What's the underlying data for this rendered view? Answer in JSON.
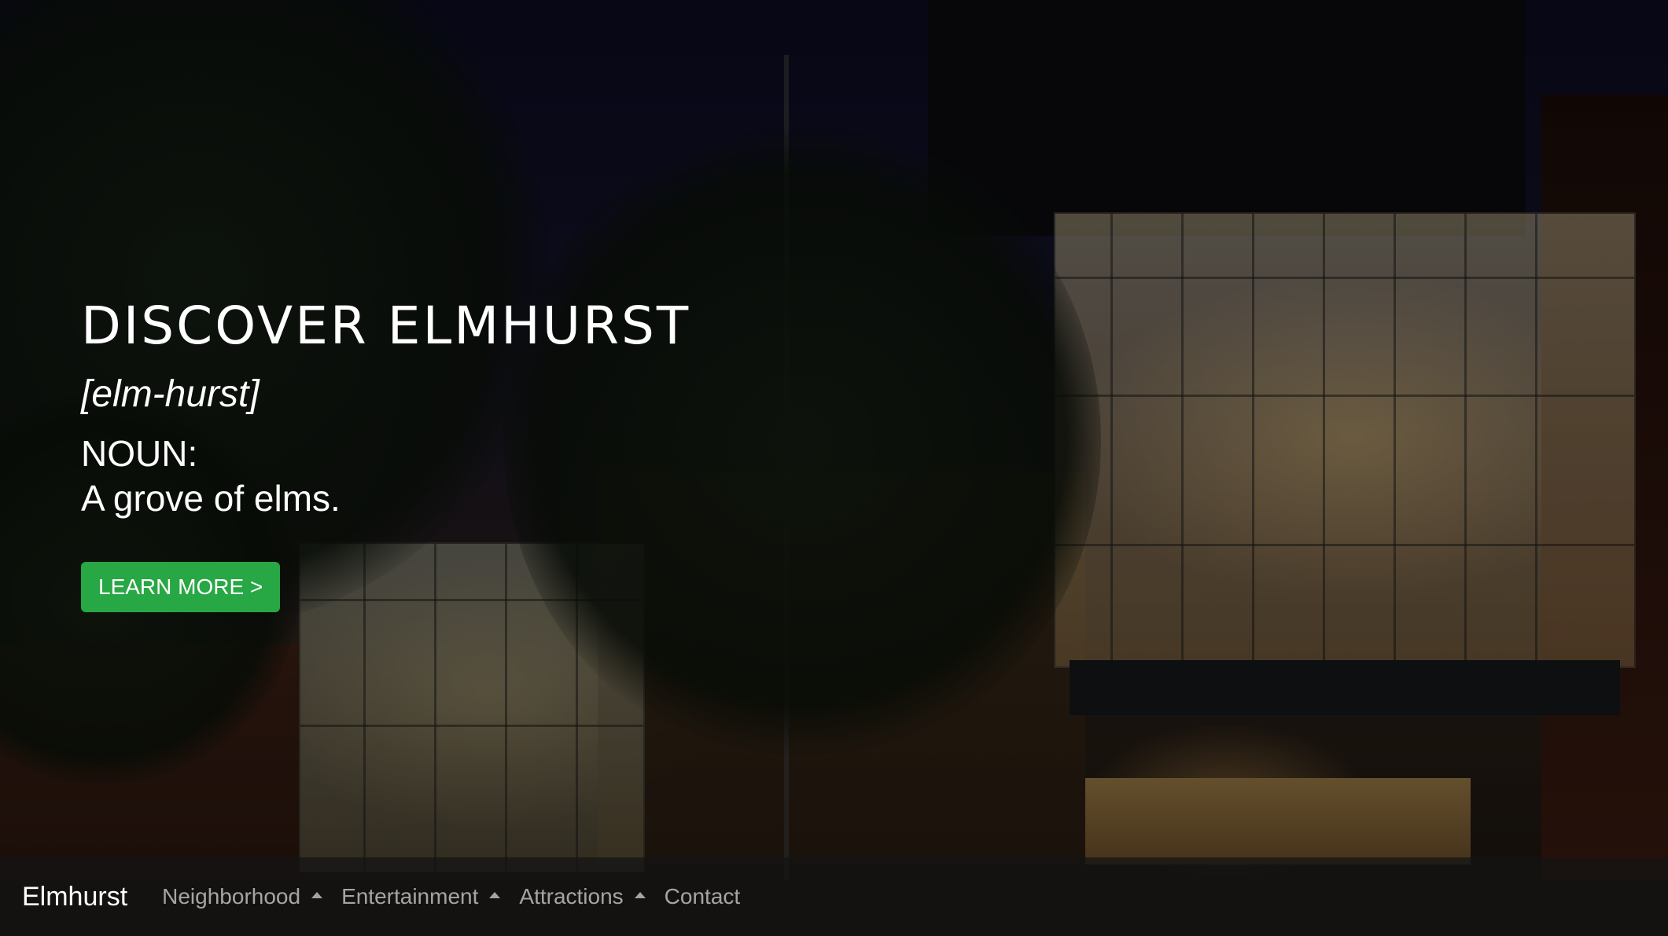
{
  "hero": {
    "title": "DISCOVER ELMHURST",
    "pronunciation": "[elm-hurst]",
    "part_of_speech": "NOUN:",
    "definition": "A grove of elms.",
    "cta_label": "LEARN MORE >"
  },
  "nav": {
    "brand": "Elmhurst",
    "items": [
      {
        "label": "Neighborhood",
        "icon": "caret-up-icon"
      },
      {
        "label": "Entertainment",
        "icon": "caret-up-icon"
      },
      {
        "label": "Attractions",
        "icon": "caret-up-icon"
      },
      {
        "label": "Contact"
      }
    ]
  },
  "colors": {
    "cta_background": "#28a745",
    "navbar_background": "rgba(20,20,20,0.75)",
    "text_primary": "#ffffff"
  }
}
